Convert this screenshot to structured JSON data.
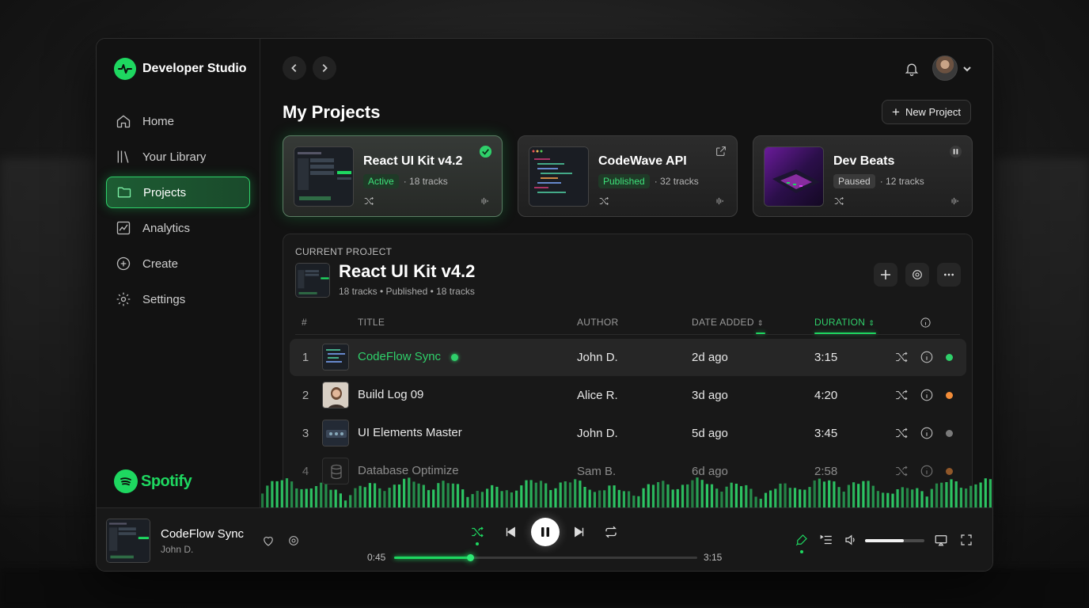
{
  "brand": {
    "title": "Developer Studio",
    "footer_logo": "Spotify"
  },
  "sidebar": {
    "items": [
      {
        "label": "Home",
        "icon": "home-icon",
        "active": false
      },
      {
        "label": "Your Library",
        "icon": "library-icon",
        "active": false
      },
      {
        "label": "Projects",
        "icon": "folder-icon",
        "active": true
      },
      {
        "label": "Analytics",
        "icon": "analytics-icon",
        "active": false
      },
      {
        "label": "Create",
        "icon": "plus-circle-icon",
        "active": false
      },
      {
        "label": "Settings",
        "icon": "gear-icon",
        "active": false
      }
    ]
  },
  "header": {
    "page_title": "My Projects",
    "new_project_label": "New Project"
  },
  "cards": [
    {
      "name": "React UI Kit v4.2",
      "status": "Active",
      "count": "· 18 tracks",
      "corner_icon": "check-circle-icon"
    },
    {
      "name": "CodeWave API",
      "status": "Published",
      "count": "· 32 tracks",
      "corner_icon": "external-link-icon"
    },
    {
      "name": "Dev Beats",
      "status": "Paused",
      "count": "· 12 tracks",
      "corner_icon": "pause-icon"
    }
  ],
  "current_project": {
    "label": "CURRENT PROJECT",
    "title": "React UI Kit v4.2",
    "subtitle": "18 tracks • Published • 18 tracks"
  },
  "table": {
    "headers": {
      "num": "#",
      "title": "TITLE",
      "author": "AUTHOR",
      "date": "DATE ADDED",
      "duration": "DURATION"
    },
    "rows": [
      {
        "num": "1",
        "title": "CodeFlow Sync",
        "author": "John D.",
        "date": "2d ago",
        "duration": "3:15",
        "status_color": "#2fd06a"
      },
      {
        "num": "2",
        "title": "Build Log 09",
        "author": "Alice R.",
        "date": "3d ago",
        "duration": "4:20",
        "status_color": "#f28c38"
      },
      {
        "num": "3",
        "title": "UI Elements Master",
        "author": "John D.",
        "date": "5d ago",
        "duration": "3:45",
        "status_color": "#7a7a7a"
      },
      {
        "num": "4",
        "title": "Database Optimize",
        "author": "Sam B.",
        "date": "6d ago",
        "duration": "2:58",
        "status_color": "#f28c38"
      }
    ]
  },
  "player": {
    "title": "CodeFlow Sync",
    "artist": "John D.",
    "elapsed": "0:45",
    "total": "3:15",
    "progress": 0.25,
    "volume": 0.65
  },
  "colors": {
    "accent": "#1ed760",
    "background": "#121212"
  }
}
